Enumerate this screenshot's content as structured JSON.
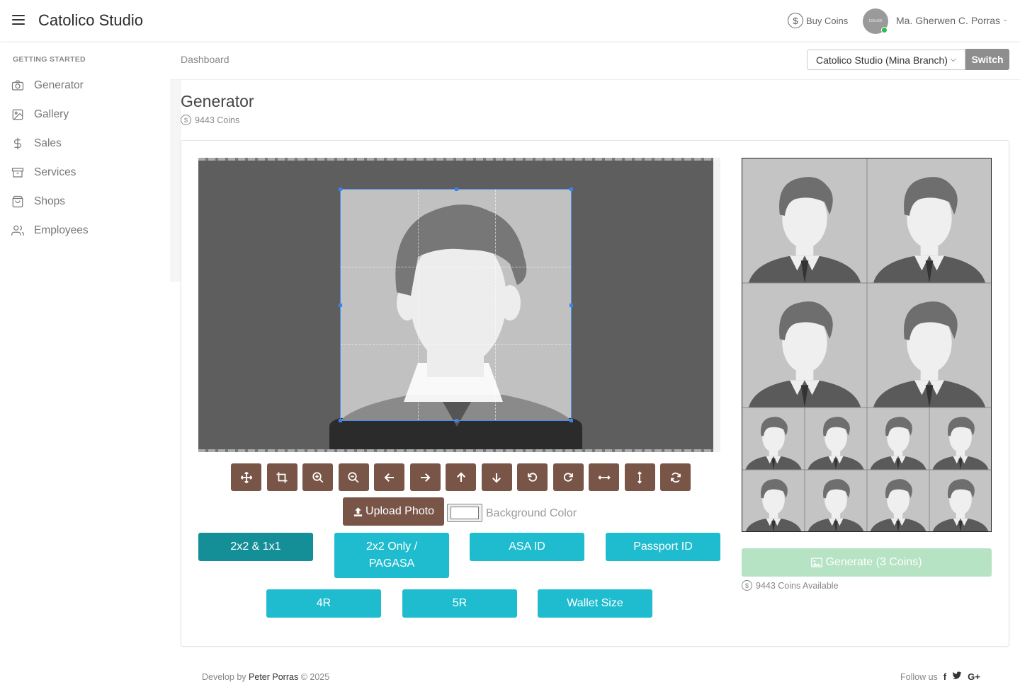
{
  "header": {
    "brand": "Catolico Studio",
    "buy_coins": "Buy Coins",
    "avatar_text": "160x160",
    "user_name": "Ma. Gherwen C. Porras"
  },
  "sidebar": {
    "heading": "GETTING STARTED",
    "items": [
      {
        "label": "Generator",
        "icon": "camera-icon"
      },
      {
        "label": "Gallery",
        "icon": "image-icon"
      },
      {
        "label": "Sales",
        "icon": "dollar-icon"
      },
      {
        "label": "Services",
        "icon": "archive-icon"
      },
      {
        "label": "Shops",
        "icon": "shopping-bag-icon"
      },
      {
        "label": "Employees",
        "icon": "users-icon"
      }
    ]
  },
  "breadcrumb": "Dashboard",
  "branch": {
    "selected": "Catolico Studio (Mina Branch)",
    "switch_label": "Switch"
  },
  "page": {
    "title": "Generator",
    "coins": "9443 Coins"
  },
  "toolbar": {
    "tools": [
      "move-icon",
      "crop-icon",
      "zoom-in-icon",
      "zoom-out-icon",
      "arrow-left-icon",
      "arrow-right-icon",
      "arrow-up-icon",
      "arrow-down-icon",
      "rotate-left-icon",
      "rotate-right-icon",
      "flip-horizontal-icon",
      "flip-vertical-icon",
      "reset-icon"
    ],
    "upload_label": "Upload Photo",
    "background_color_label": "Background Color",
    "background_color": "#ffffff"
  },
  "sizes": [
    "2x2 & 1x1",
    "2x2 Only / PAGASA",
    "ASA ID",
    "Passport ID",
    "4R",
    "5R",
    "Wallet Size"
  ],
  "generate": {
    "label": "Generate (3 Coins)",
    "coins_available": "9443 Coins Available"
  },
  "footer": {
    "develop_by": "Develop by",
    "author": "Peter Porras",
    "copyright": "© 2025",
    "follow_us": "Follow us",
    "socials": [
      "f",
      "t",
      "G+"
    ]
  },
  "colors": {
    "brown": "#795548",
    "cyan": "#1fbccf",
    "cyan_active": "#148f98",
    "generate_disabled": "#b5e3c3",
    "crop_border": "#4a8ef0"
  }
}
